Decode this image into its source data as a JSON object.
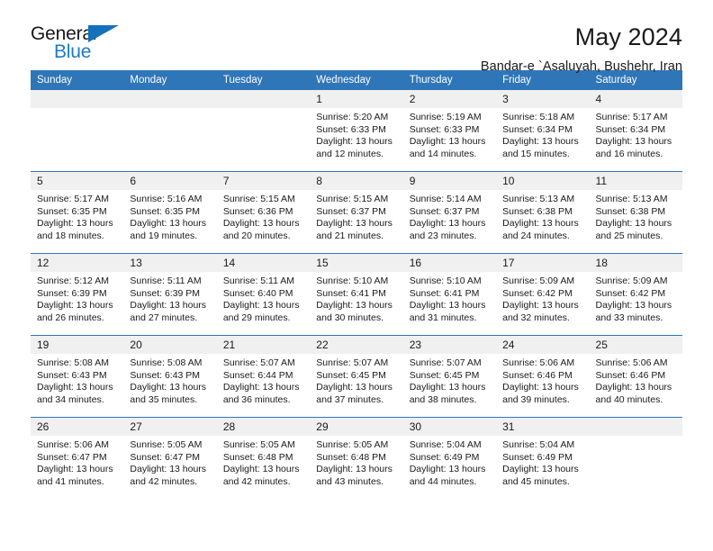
{
  "logo": {
    "word_top": "General",
    "word_bottom": "Blue",
    "accent_color": "#1571bb"
  },
  "header": {
    "title": "May 2024",
    "subtitle": "Bandar-e `Asaluyah, Bushehr, Iran"
  },
  "calendar": {
    "header_bg": "#2f76b8",
    "daynum_bg": "#f0f0f0",
    "weekday_headers": [
      "Sunday",
      "Monday",
      "Tuesday",
      "Wednesday",
      "Thursday",
      "Friday",
      "Saturday"
    ],
    "weeks": [
      [
        {
          "day": "",
          "lines": []
        },
        {
          "day": "",
          "lines": []
        },
        {
          "day": "",
          "lines": []
        },
        {
          "day": "1",
          "lines": [
            "Sunrise: 5:20 AM",
            "Sunset: 6:33 PM",
            "Daylight: 13 hours",
            "and 12 minutes."
          ]
        },
        {
          "day": "2",
          "lines": [
            "Sunrise: 5:19 AM",
            "Sunset: 6:33 PM",
            "Daylight: 13 hours",
            "and 14 minutes."
          ]
        },
        {
          "day": "3",
          "lines": [
            "Sunrise: 5:18 AM",
            "Sunset: 6:34 PM",
            "Daylight: 13 hours",
            "and 15 minutes."
          ]
        },
        {
          "day": "4",
          "lines": [
            "Sunrise: 5:17 AM",
            "Sunset: 6:34 PM",
            "Daylight: 13 hours",
            "and 16 minutes."
          ]
        }
      ],
      [
        {
          "day": "5",
          "lines": [
            "Sunrise: 5:17 AM",
            "Sunset: 6:35 PM",
            "Daylight: 13 hours",
            "and 18 minutes."
          ]
        },
        {
          "day": "6",
          "lines": [
            "Sunrise: 5:16 AM",
            "Sunset: 6:35 PM",
            "Daylight: 13 hours",
            "and 19 minutes."
          ]
        },
        {
          "day": "7",
          "lines": [
            "Sunrise: 5:15 AM",
            "Sunset: 6:36 PM",
            "Daylight: 13 hours",
            "and 20 minutes."
          ]
        },
        {
          "day": "8",
          "lines": [
            "Sunrise: 5:15 AM",
            "Sunset: 6:37 PM",
            "Daylight: 13 hours",
            "and 21 minutes."
          ]
        },
        {
          "day": "9",
          "lines": [
            "Sunrise: 5:14 AM",
            "Sunset: 6:37 PM",
            "Daylight: 13 hours",
            "and 23 minutes."
          ]
        },
        {
          "day": "10",
          "lines": [
            "Sunrise: 5:13 AM",
            "Sunset: 6:38 PM",
            "Daylight: 13 hours",
            "and 24 minutes."
          ]
        },
        {
          "day": "11",
          "lines": [
            "Sunrise: 5:13 AM",
            "Sunset: 6:38 PM",
            "Daylight: 13 hours",
            "and 25 minutes."
          ]
        }
      ],
      [
        {
          "day": "12",
          "lines": [
            "Sunrise: 5:12 AM",
            "Sunset: 6:39 PM",
            "Daylight: 13 hours",
            "and 26 minutes."
          ]
        },
        {
          "day": "13",
          "lines": [
            "Sunrise: 5:11 AM",
            "Sunset: 6:39 PM",
            "Daylight: 13 hours",
            "and 27 minutes."
          ]
        },
        {
          "day": "14",
          "lines": [
            "Sunrise: 5:11 AM",
            "Sunset: 6:40 PM",
            "Daylight: 13 hours",
            "and 29 minutes."
          ]
        },
        {
          "day": "15",
          "lines": [
            "Sunrise: 5:10 AM",
            "Sunset: 6:41 PM",
            "Daylight: 13 hours",
            "and 30 minutes."
          ]
        },
        {
          "day": "16",
          "lines": [
            "Sunrise: 5:10 AM",
            "Sunset: 6:41 PM",
            "Daylight: 13 hours",
            "and 31 minutes."
          ]
        },
        {
          "day": "17",
          "lines": [
            "Sunrise: 5:09 AM",
            "Sunset: 6:42 PM",
            "Daylight: 13 hours",
            "and 32 minutes."
          ]
        },
        {
          "day": "18",
          "lines": [
            "Sunrise: 5:09 AM",
            "Sunset: 6:42 PM",
            "Daylight: 13 hours",
            "and 33 minutes."
          ]
        }
      ],
      [
        {
          "day": "19",
          "lines": [
            "Sunrise: 5:08 AM",
            "Sunset: 6:43 PM",
            "Daylight: 13 hours",
            "and 34 minutes."
          ]
        },
        {
          "day": "20",
          "lines": [
            "Sunrise: 5:08 AM",
            "Sunset: 6:43 PM",
            "Daylight: 13 hours",
            "and 35 minutes."
          ]
        },
        {
          "day": "21",
          "lines": [
            "Sunrise: 5:07 AM",
            "Sunset: 6:44 PM",
            "Daylight: 13 hours",
            "and 36 minutes."
          ]
        },
        {
          "day": "22",
          "lines": [
            "Sunrise: 5:07 AM",
            "Sunset: 6:45 PM",
            "Daylight: 13 hours",
            "and 37 minutes."
          ]
        },
        {
          "day": "23",
          "lines": [
            "Sunrise: 5:07 AM",
            "Sunset: 6:45 PM",
            "Daylight: 13 hours",
            "and 38 minutes."
          ]
        },
        {
          "day": "24",
          "lines": [
            "Sunrise: 5:06 AM",
            "Sunset: 6:46 PM",
            "Daylight: 13 hours",
            "and 39 minutes."
          ]
        },
        {
          "day": "25",
          "lines": [
            "Sunrise: 5:06 AM",
            "Sunset: 6:46 PM",
            "Daylight: 13 hours",
            "and 40 minutes."
          ]
        }
      ],
      [
        {
          "day": "26",
          "lines": [
            "Sunrise: 5:06 AM",
            "Sunset: 6:47 PM",
            "Daylight: 13 hours",
            "and 41 minutes."
          ]
        },
        {
          "day": "27",
          "lines": [
            "Sunrise: 5:05 AM",
            "Sunset: 6:47 PM",
            "Daylight: 13 hours",
            "and 42 minutes."
          ]
        },
        {
          "day": "28",
          "lines": [
            "Sunrise: 5:05 AM",
            "Sunset: 6:48 PM",
            "Daylight: 13 hours",
            "and 42 minutes."
          ]
        },
        {
          "day": "29",
          "lines": [
            "Sunrise: 5:05 AM",
            "Sunset: 6:48 PM",
            "Daylight: 13 hours",
            "and 43 minutes."
          ]
        },
        {
          "day": "30",
          "lines": [
            "Sunrise: 5:04 AM",
            "Sunset: 6:49 PM",
            "Daylight: 13 hours",
            "and 44 minutes."
          ]
        },
        {
          "day": "31",
          "lines": [
            "Sunrise: 5:04 AM",
            "Sunset: 6:49 PM",
            "Daylight: 13 hours",
            "and 45 minutes."
          ]
        },
        {
          "day": "",
          "lines": []
        }
      ]
    ]
  }
}
